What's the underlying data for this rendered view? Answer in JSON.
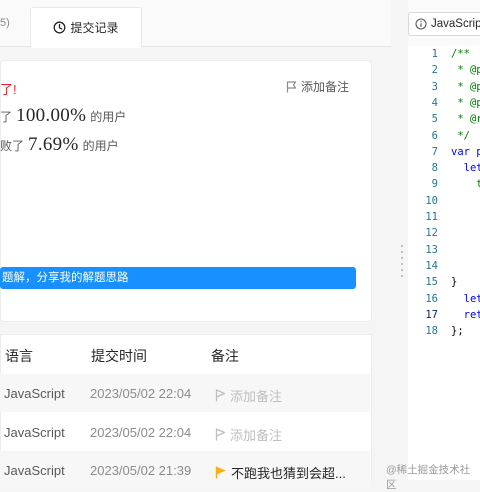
{
  "tabs": {
    "prev_partial": "5)",
    "active": "提交记录"
  },
  "result": {
    "status": "了!",
    "add_note": "添加备注",
    "runtime_prefix": "了",
    "runtime_value": "100.00%",
    "runtime_suffix": "的用户",
    "memory_prefix": "败了",
    "memory_value": "7.69%",
    "memory_suffix": "的用户",
    "share": "题解，分享我的解题思路"
  },
  "table": {
    "headers": {
      "language": "语言",
      "time": "提交时间",
      "remark": "备注"
    },
    "rows": [
      {
        "language": "JavaScript",
        "time": "2023/05/02 22:04",
        "remark": "添加备注"
      },
      {
        "language": "JavaScript",
        "time": "2023/05/02 22:04",
        "remark": "添加备注"
      },
      {
        "language": "JavaScript",
        "time": "2023/05/02 21:39",
        "remark": "不跑我也猜到会超..."
      }
    ]
  },
  "editor": {
    "language": "JavaScript",
    "lines": [
      {
        "n": "1",
        "text": "/**"
      },
      {
        "n": "2",
        "text": " * @p"
      },
      {
        "n": "3",
        "text": " * @p"
      },
      {
        "n": "4",
        "text": " * @p"
      },
      {
        "n": "5",
        "text": " * @r"
      },
      {
        "n": "6",
        "text": " */"
      },
      {
        "n": "7",
        "text": "var p"
      },
      {
        "n": "8",
        "text": "  let"
      },
      {
        "n": "9",
        "text": "    t"
      },
      {
        "n": "10",
        "text": ""
      },
      {
        "n": "11",
        "text": ""
      },
      {
        "n": "12",
        "text": ""
      },
      {
        "n": "13",
        "text": ""
      },
      {
        "n": "14",
        "text": ""
      },
      {
        "n": "15",
        "text": "}"
      },
      {
        "n": "16",
        "text": "  let"
      },
      {
        "n": "17",
        "text": "  ret"
      },
      {
        "n": "18",
        "text": "};"
      }
    ]
  },
  "watermark": "@稀土掘金技术社区",
  "colors": {
    "accent": "#1890ff",
    "flag": "#faad14",
    "error": "#f5222d"
  }
}
